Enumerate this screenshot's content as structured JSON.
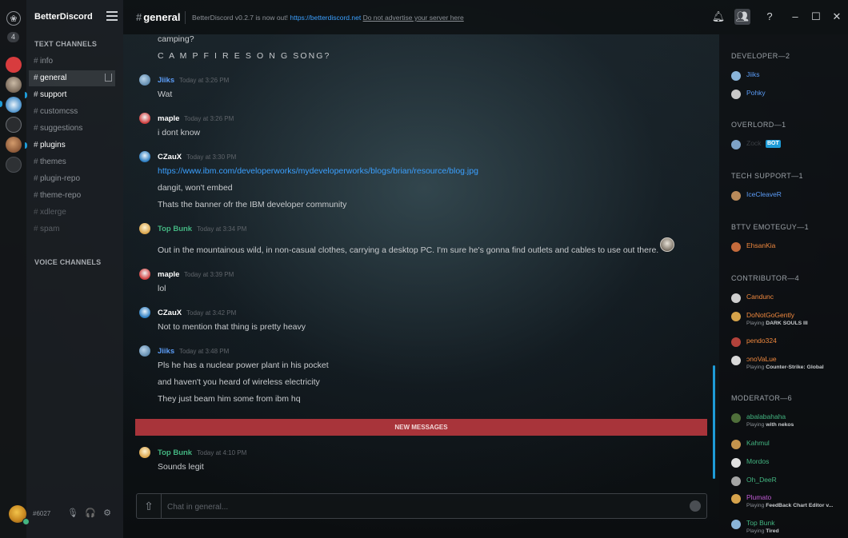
{
  "colors": {
    "accent": "#1e9bd7",
    "new_messages_bar": "#a8343a",
    "link": "#3ba0ff",
    "online": "#43b581"
  },
  "guilds": {
    "home_glyph": "❀",
    "mention_count": "4"
  },
  "server": {
    "name": "BetterDiscord",
    "menu_icon": "hamburger-icon"
  },
  "sidebar": {
    "text_channels_label": "TEXT CHANNELS",
    "voice_channels_label": "VOICE CHANNELS",
    "channels": [
      {
        "name": "info",
        "state": "normal"
      },
      {
        "name": "general",
        "state": "active"
      },
      {
        "name": "support",
        "state": "unread"
      },
      {
        "name": "customcss",
        "state": "normal"
      },
      {
        "name": "suggestions",
        "state": "normal"
      },
      {
        "name": "plugins",
        "state": "unread"
      },
      {
        "name": "themes",
        "state": "normal"
      },
      {
        "name": "plugin-repo",
        "state": "normal"
      },
      {
        "name": "theme-repo",
        "state": "normal"
      },
      {
        "name": "xdlerge",
        "state": "dim"
      },
      {
        "name": "spam",
        "state": "dim"
      }
    ]
  },
  "user_panel": {
    "discriminator": "#6027",
    "icons": [
      "microphone-icon",
      "headphones-icon",
      "gear-icon"
    ]
  },
  "topbar": {
    "channel": "general",
    "topic_prefix": "BetterDiscord v0.2.7 is now out! ",
    "topic_link": "https://betterdiscord.net",
    "topic_suffix": "Do not advertise your server here",
    "icons": [
      "bell-icon",
      "members-icon",
      "help-icon",
      "minimize-icon",
      "maximize-icon",
      "close-icon"
    ]
  },
  "messages": [
    {
      "type": "line",
      "text": "camping?"
    },
    {
      "type": "line",
      "text": "C A M P F I R E S O N G SONG?"
    },
    {
      "type": "author",
      "author": "Jiiks",
      "color": "#5b9cf6",
      "time": "Today at 3:26 PM"
    },
    {
      "type": "line",
      "text": "Wat"
    },
    {
      "type": "author",
      "author": "maple",
      "color": "#ffffff",
      "time": "Today at 3:26 PM"
    },
    {
      "type": "line",
      "text": "i dont know"
    },
    {
      "type": "author",
      "author": "CZauX",
      "color": "#ffffff",
      "time": "Today at 3:30 PM"
    },
    {
      "type": "link",
      "text": "https://www.ibm.com/developerworks/mydeveloperworks/blogs/brian/resource/blog.jpg"
    },
    {
      "type": "line",
      "text": "dangit, won't embed"
    },
    {
      "type": "line",
      "text": "Thats the banner ofr the IBM developer community"
    },
    {
      "type": "author",
      "author": "Top Bunk",
      "color": "#43b581",
      "time": "Today at 3:34 PM"
    },
    {
      "type": "line",
      "text": "Out in the mountainous wild, in non-casual clothes, carrying a desktop PC. I'm sure he's gonna find outlets and cables to use out there."
    },
    {
      "type": "author",
      "author": "maple",
      "color": "#ffffff",
      "time": "Today at 3:39 PM"
    },
    {
      "type": "line",
      "text": "lol"
    },
    {
      "type": "author",
      "author": "CZauX",
      "color": "#ffffff",
      "time": "Today at 3:42 PM"
    },
    {
      "type": "line",
      "text": "Not to mention that thing is pretty heavy"
    },
    {
      "type": "author",
      "author": "Jiiks",
      "color": "#5b9cf6",
      "time": "Today at 3:48 PM"
    },
    {
      "type": "line",
      "text": "Pls he has a nuclear power plant in his pocket"
    },
    {
      "type": "line",
      "text": "and haven't you heard of wireless electricity"
    },
    {
      "type": "line",
      "text": "They just beam him some from ibm hq"
    },
    {
      "type": "divider",
      "text": "NEW MESSAGES"
    },
    {
      "type": "author",
      "author": "Top Bunk",
      "color": "#43b581",
      "time": "Today at 4:10 PM"
    },
    {
      "type": "line",
      "text": "Sounds legit"
    }
  ],
  "composer": {
    "placeholder": "Chat in general..."
  },
  "members": {
    "roles": [
      {
        "label": "DEVELOPER—2",
        "members": [
          {
            "name": "Jiiks",
            "color": "#5b9cf6"
          },
          {
            "name": "Pohky",
            "color": "#5b9cf6"
          }
        ]
      },
      {
        "label": "OVERLORD—1",
        "members": [
          {
            "name": "Zock",
            "color": "#3a3e43",
            "badge": "BOT"
          }
        ]
      },
      {
        "label": "TECH SUPPORT—1",
        "members": [
          {
            "name": "IceCleaveR",
            "color": "#5b9cf6"
          }
        ]
      },
      {
        "label": "BTTV EMOTEGUY—1",
        "members": [
          {
            "name": "EhsanKia",
            "color": "#f0883e"
          }
        ]
      },
      {
        "label": "CONTRIBUTOR—4",
        "members": [
          {
            "name": "Candunc",
            "color": "#f0883e"
          },
          {
            "name": "DoNotGoGently",
            "color": "#f0883e",
            "playing": "Playing",
            "game": "DARK SOULS III"
          },
          {
            "name": "pendo324",
            "color": "#f0883e"
          },
          {
            "name": "ↄnoVaLue",
            "color": "#f0883e",
            "playing": "Playing",
            "game": "Counter-Strike: Global"
          }
        ]
      },
      {
        "label": "MODERATOR—6",
        "members": [
          {
            "name": "abalabahaha",
            "color": "#43b581",
            "playing": "Playing",
            "game": "with nekos"
          },
          {
            "name": "Kahmul",
            "color": "#43b581"
          },
          {
            "name": "Mordos",
            "color": "#43b581"
          },
          {
            "name": "Oh_DeeR",
            "color": "#43b581"
          },
          {
            "name": "Plumato",
            "color": "#c15bd6",
            "playing": "Playing",
            "game": "FeedBack Chart Editor v..."
          },
          {
            "name": "Top Bunk",
            "color": "#43b581",
            "playing": "Playing",
            "game": "Tired"
          }
        ]
      }
    ]
  }
}
